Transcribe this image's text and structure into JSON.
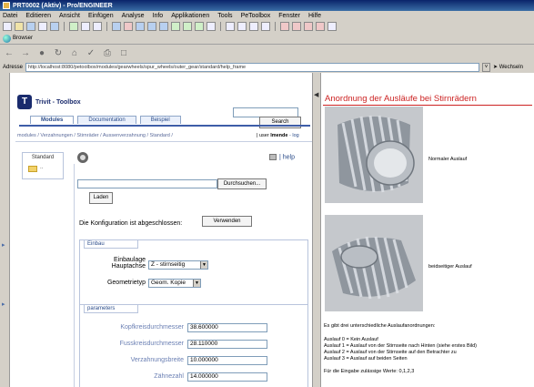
{
  "window": {
    "title": "PRT0002 (Aktiv) - Pro/ENGINEER"
  },
  "menu": [
    "Datei",
    "Editieren",
    "Ansicht",
    "Einfügen",
    "Analyse",
    "Info",
    "Applikationen",
    "Tools",
    "PeToolbox",
    "Fenster",
    "Hilfe"
  ],
  "browser": {
    "tab_label": "Browser",
    "address_label": "Adresse",
    "url": "http://localhost:8080/petoolbox/modules/gearwheels/spur_wheels/outer_gear/standard/help_frame",
    "go_label": "Wechseln"
  },
  "toolbox": {
    "logo_letter": "T",
    "brand": "Trivit - Toolbox",
    "search_label": "Search",
    "tabs": [
      "Modules",
      "Documentation",
      "Beispiel"
    ],
    "breadcrumb": "modules / Verzahnungen / Stirnräder / Aussenverzahnung / Standard /",
    "user_prefix": "| user",
    "user_name": "lmende",
    "logout": "- log",
    "side_label": "Standard",
    "side_dots": "..",
    "help_label": "| help",
    "browse_label": "Durchsuchen...",
    "load_label": "Laden",
    "config_text": "Die Konfiguration ist abgeschlossen:",
    "apply_label": "Verwenden"
  },
  "einbau": {
    "legend": "Einbau",
    "einbaulage_label_1": "Einbaulage",
    "einbaulage_label_2": "Hauptachse",
    "einbaulage_value": "Z - stirnseitig",
    "geometrietyp_label": "Geometrietyp",
    "geometrietyp_value": "Geom. Kopie"
  },
  "parameters": {
    "legend": "parameters",
    "rows": [
      {
        "label": "Kopfkreisdurchmesser",
        "value": "38.600000"
      },
      {
        "label": "Fusskreisdurchmesser",
        "value": "28.110000"
      },
      {
        "label": "Verzahnungsbreite",
        "value": "10.000000"
      },
      {
        "label": "Zähnezahl",
        "value": "14.000000"
      }
    ]
  },
  "help": {
    "title": "Anordnung der Ausläufe bei Stirnrädern",
    "caption_1": "Normaler Auslauf",
    "caption_2": "beidseitiger Auslauf",
    "intro": "Es gibt drei unterschiedliche Auslaufanordnungen:",
    "lines": [
      "Auslauf 0 = Kein Auslauf",
      "Auslauf 1 = Auslauf von der Stirnseite nach Hinten (siehe erstes Bild)",
      "Auslauf 2 = Auslauf von der Stirnseite auf den Betrachter zu",
      "Auslauf 3 = Auslauf auf beiden Seiten"
    ],
    "allowed": "Für die Eingabe zulässige Werte: 0,1,2,3"
  }
}
